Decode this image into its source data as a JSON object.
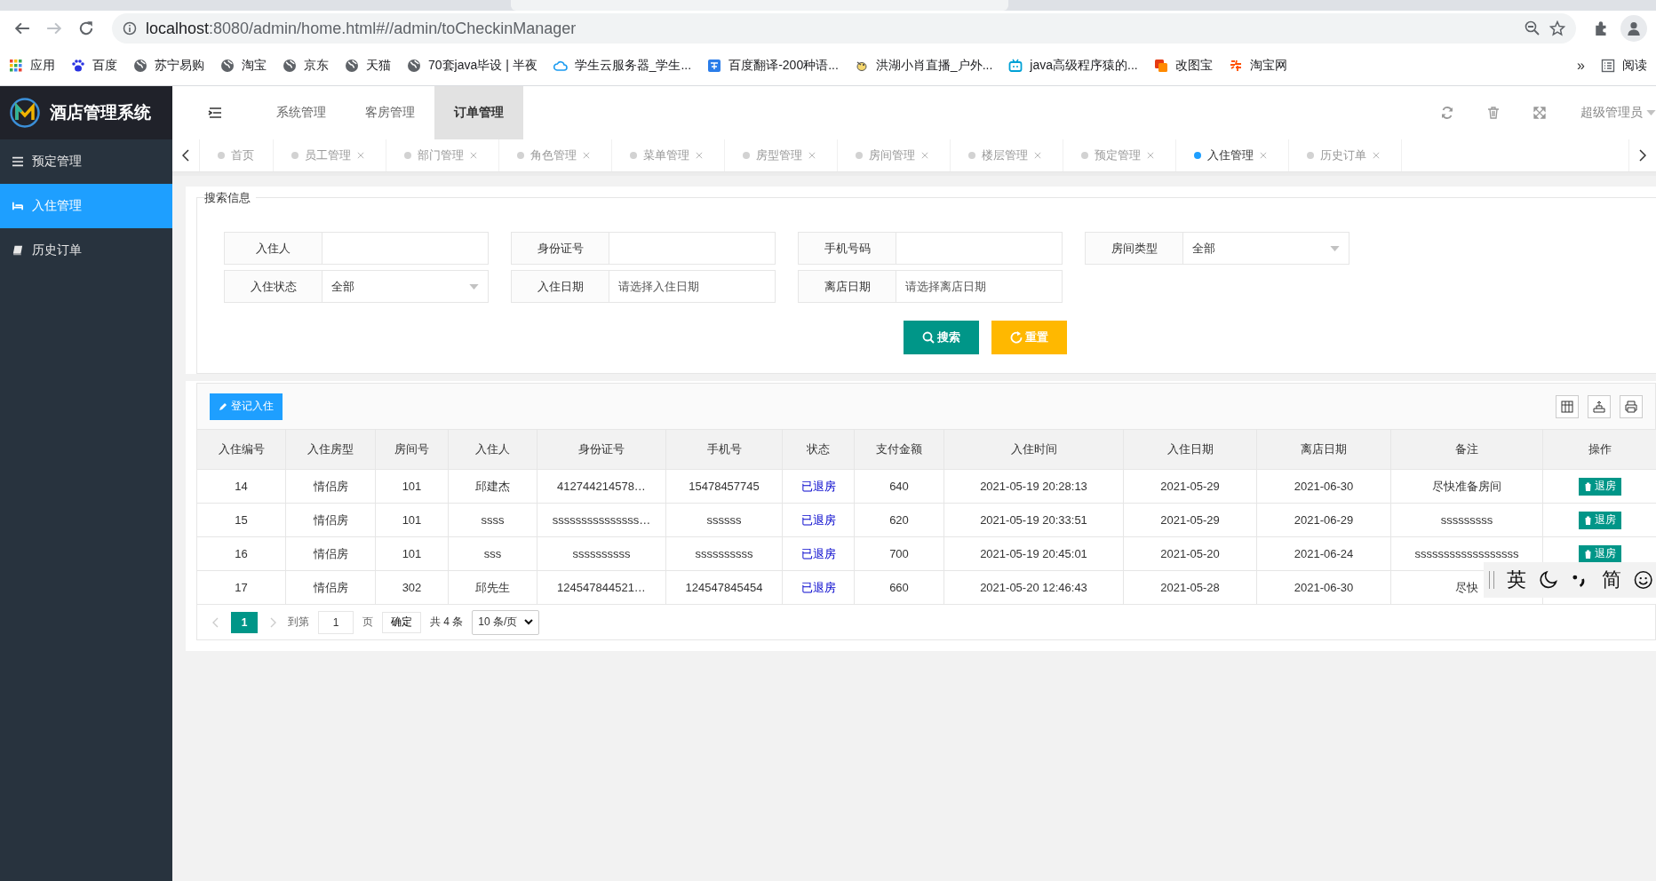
{
  "browser": {
    "url_host": "localhost",
    "url_rest": ":8080/admin/home.html#//admin/toCheckinManager",
    "bookmarks": [
      {
        "label": "应用",
        "kind": "apps"
      },
      {
        "label": "百度",
        "kind": "paw"
      },
      {
        "label": "苏宁易购",
        "kind": "globe"
      },
      {
        "label": "淘宝",
        "kind": "globe"
      },
      {
        "label": "京东",
        "kind": "globe"
      },
      {
        "label": "天猫",
        "kind": "globe"
      },
      {
        "label": "70套java毕设 | 半夜",
        "kind": "globe"
      },
      {
        "label": "学生云服务器_学生...",
        "kind": "cloud"
      },
      {
        "label": "百度翻译-200种语...",
        "kind": "translate"
      },
      {
        "label": "洪湖小肖直播_户外...",
        "kind": "bird"
      },
      {
        "label": "java高级程序猿的...",
        "kind": "tv"
      },
      {
        "label": "改图宝",
        "kind": "image"
      },
      {
        "label": "淘宝网",
        "kind": "shop"
      }
    ],
    "overflow": "»",
    "reading_list": "阅读"
  },
  "app": {
    "title": "酒店管理系统"
  },
  "sidebar": {
    "items": [
      {
        "label": "预定管理",
        "kind": "list",
        "selected": false
      },
      {
        "label": "入住管理",
        "kind": "bed",
        "selected": true
      },
      {
        "label": "历史订单",
        "kind": "book",
        "selected": false
      }
    ]
  },
  "topnav": {
    "items": [
      {
        "label": "系统管理",
        "selected": false
      },
      {
        "label": "客房管理",
        "selected": false
      },
      {
        "label": "订单管理",
        "selected": true
      }
    ],
    "user": "超级管理员"
  },
  "page_tabs": {
    "items": [
      {
        "label": "首页",
        "selected": false,
        "closable": false
      },
      {
        "label": "员工管理",
        "selected": false,
        "closable": true
      },
      {
        "label": "部门管理",
        "selected": false,
        "closable": true
      },
      {
        "label": "角色管理",
        "selected": false,
        "closable": true
      },
      {
        "label": "菜单管理",
        "selected": false,
        "closable": true
      },
      {
        "label": "房型管理",
        "selected": false,
        "closable": true
      },
      {
        "label": "房间管理",
        "selected": false,
        "closable": true
      },
      {
        "label": "楼层管理",
        "selected": false,
        "closable": true
      },
      {
        "label": "预定管理",
        "selected": false,
        "closable": true
      },
      {
        "label": "入住管理",
        "selected": true,
        "closable": true
      },
      {
        "label": "历史订单",
        "selected": false,
        "closable": true
      }
    ]
  },
  "search": {
    "legend": "搜索信息",
    "fields": [
      {
        "label": "入住人",
        "kind": "input"
      },
      {
        "label": "身份证号",
        "kind": "input"
      },
      {
        "label": "手机号码",
        "kind": "input"
      },
      {
        "label": "房间类型",
        "kind": "select",
        "value": "全部"
      },
      {
        "label": "入住状态",
        "kind": "select",
        "value": "全部"
      },
      {
        "label": "入住日期",
        "kind": "date",
        "placeholder": "请选择入住日期"
      },
      {
        "label": "离店日期",
        "kind": "date",
        "placeholder": "请选择离店日期"
      }
    ],
    "buttons": [
      {
        "label": "搜索",
        "kind": "search"
      },
      {
        "label": "重置",
        "kind": "reset"
      }
    ]
  },
  "table": {
    "add_button": "登记入住",
    "columns": [
      {
        "label": "入住编号",
        "kind": "text"
      },
      {
        "label": "入住房型",
        "kind": "text"
      },
      {
        "label": "房间号",
        "kind": "text"
      },
      {
        "label": "入住人",
        "kind": "text"
      },
      {
        "label": "身份证号",
        "kind": "text"
      },
      {
        "label": "手机号",
        "kind": "text"
      },
      {
        "label": "状态",
        "kind": "link"
      },
      {
        "label": "支付金额",
        "kind": "text"
      },
      {
        "label": "入住时间",
        "kind": "text"
      },
      {
        "label": "入住日期",
        "kind": "text"
      },
      {
        "label": "离店日期",
        "kind": "text"
      },
      {
        "label": "备注",
        "kind": "text"
      },
      {
        "label": "操作",
        "kind": "action"
      }
    ],
    "rows": [
      {
        "cells": [
          "14",
          "情侣房",
          "101",
          "邱建杰",
          "412744214578…",
          "15478457745",
          "已退房",
          "640",
          "2021-05-19 20:28:13",
          "2021-05-29",
          "2021-06-30",
          "尽快准备房间",
          "退房"
        ]
      },
      {
        "cells": [
          "15",
          "情侣房",
          "101",
          "ssss",
          "sssssssssssssss…",
          "ssssss",
          "已退房",
          "620",
          "2021-05-19 20:33:51",
          "2021-05-29",
          "2021-06-29",
          "sssssssss",
          "退房"
        ]
      },
      {
        "cells": [
          "16",
          "情侣房",
          "101",
          "sss",
          "ssssssssss",
          "ssssssssss",
          "已退房",
          "700",
          "2021-05-19 20:45:01",
          "2021-05-20",
          "2021-06-24",
          "ssssssssssssssssss",
          "退房"
        ]
      },
      {
        "cells": [
          "17",
          "情侣房",
          "302",
          "邱先生",
          "124547844521…",
          "124547845454",
          "已退房",
          "660",
          "2021-05-20 12:46:43",
          "2021-05-28",
          "2021-06-30",
          "尽快"
        ]
      }
    ]
  },
  "pagination": {
    "current": "1",
    "goto_label": "到第",
    "goto_value": "1",
    "page_label": "页",
    "confirm": "确定",
    "total": "共 4 条",
    "page_size": "10 条/页"
  },
  "ime": {
    "mode": "英",
    "script": "简"
  }
}
